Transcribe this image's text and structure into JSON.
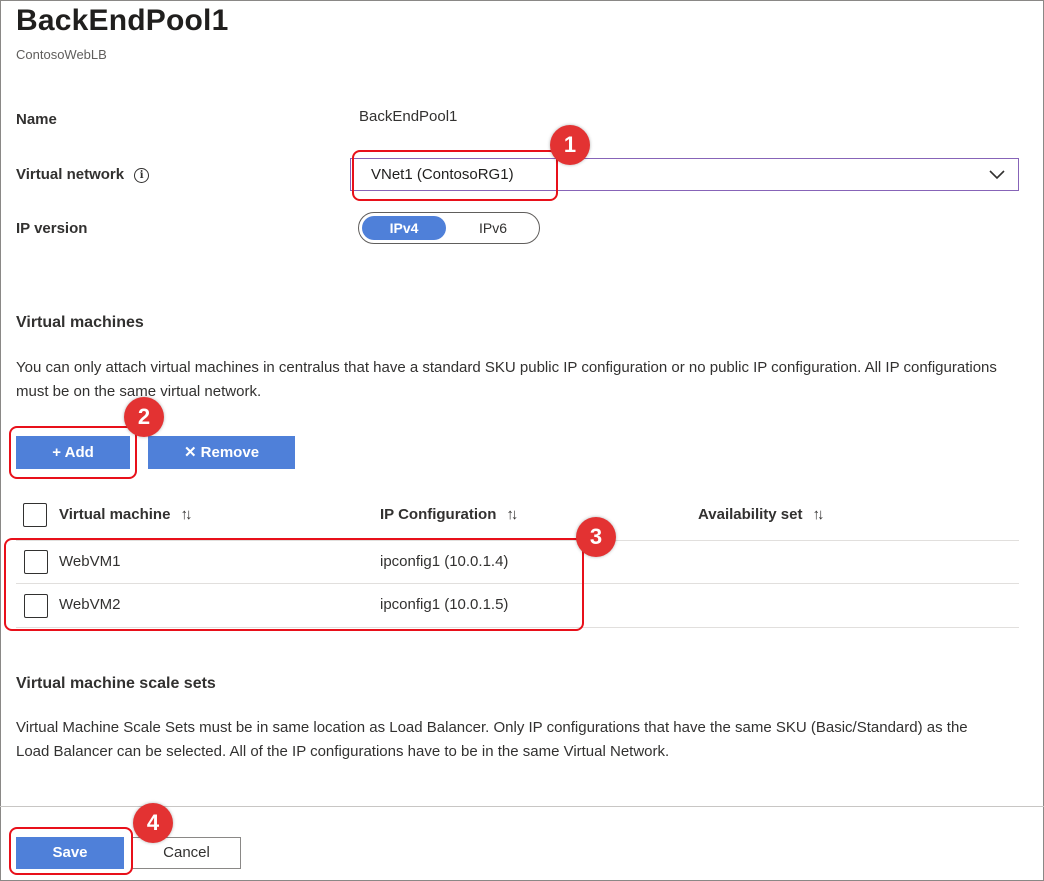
{
  "header": {
    "title": "BackEndPool1",
    "subtitle": "ContosoWebLB"
  },
  "form": {
    "name_label": "Name",
    "name_value": "BackEndPool1",
    "vnet_label": "Virtual network",
    "vnet_value": "VNet1 (ContosoRG1)",
    "ipversion_label": "IP version",
    "ipversion_options": [
      "IPv4",
      "IPv6"
    ],
    "ipversion_selected": "IPv4"
  },
  "vms": {
    "title": "Virtual machines",
    "description": "You can only attach virtual machines in centralus that have a standard SKU public IP configuration or no public IP configuration. All IP configurations must be on the same virtual network.",
    "add_label": "+ Add",
    "remove_label": "✕ Remove",
    "columns": [
      "Virtual machine",
      "IP Configuration",
      "Availability set"
    ],
    "rows": [
      {
        "vm": "WebVM1",
        "ipconfig": "ipconfig1 (10.0.1.4)",
        "availability": ""
      },
      {
        "vm": "WebVM2",
        "ipconfig": "ipconfig1 (10.0.1.5)",
        "availability": ""
      }
    ]
  },
  "vmss": {
    "title": "Virtual machine scale sets",
    "description": "Virtual Machine Scale Sets must be in same location as Load Balancer. Only IP configurations that have the same SKU (Basic/Standard) as the Load Balancer can be selected. All of the IP configurations have to be in the same Virtual Network."
  },
  "footer": {
    "save_label": "Save",
    "cancel_label": "Cancel"
  },
  "callouts": [
    "1",
    "2",
    "3",
    "4"
  ],
  "colors": {
    "primary": "#4f80d9",
    "callout": "#e33232",
    "dropdown_border": "#8764b8"
  }
}
